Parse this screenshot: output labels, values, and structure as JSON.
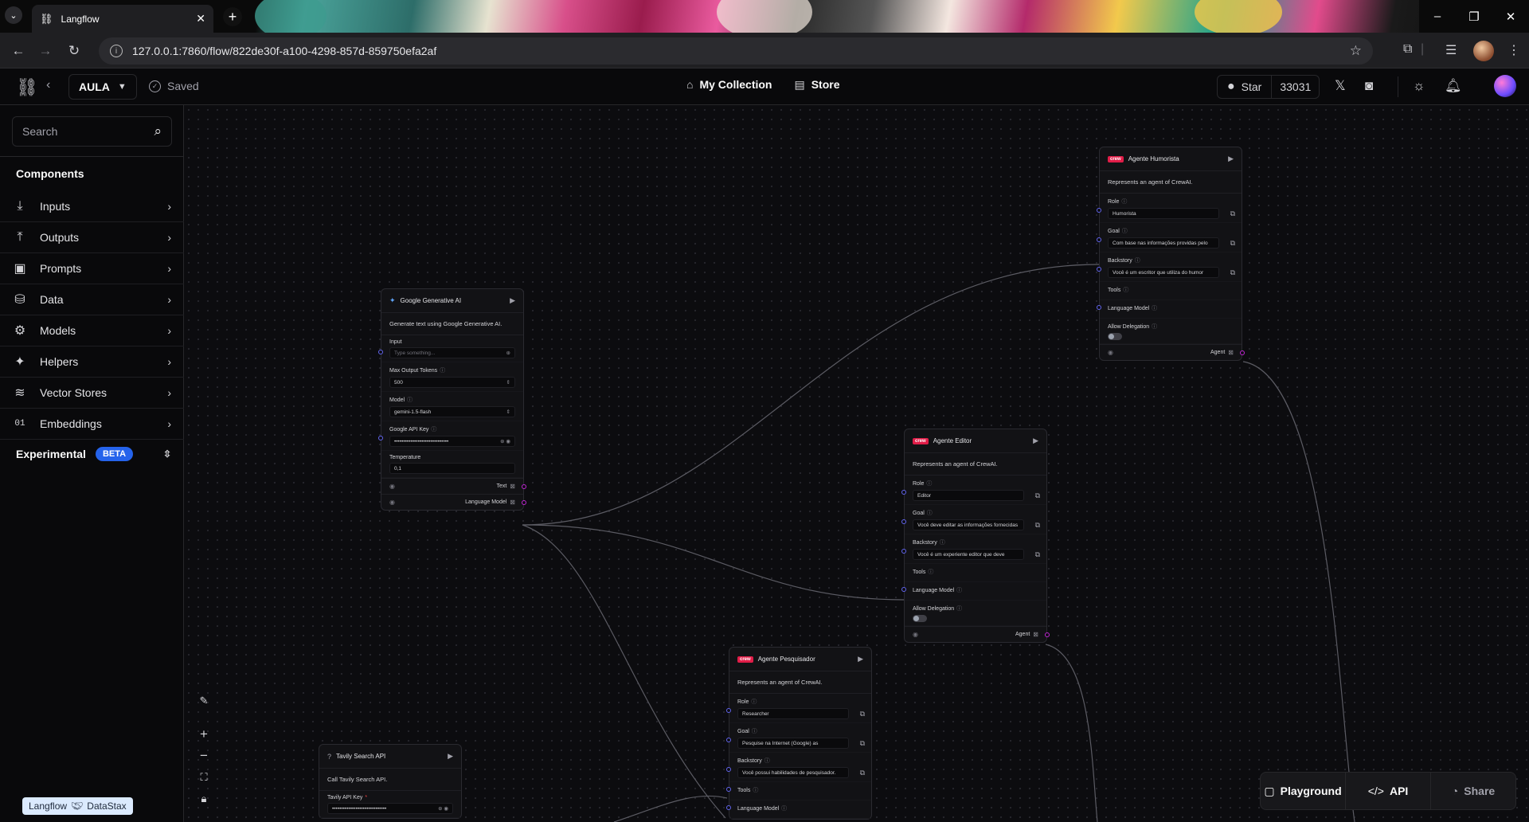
{
  "browser": {
    "tab_title": "Langflow",
    "url": "127.0.0.1:7860/flow/822de30f-a100-4298-857d-859750efa2af"
  },
  "header": {
    "flow_name": "AULA",
    "saved_label": "Saved",
    "nav": {
      "collection": "My Collection",
      "store": "Store"
    },
    "github": {
      "star_label": "Star",
      "star_count": "33031"
    }
  },
  "sidebar": {
    "search_placeholder": "Search",
    "components_title": "Components",
    "categories": [
      {
        "label": "Inputs",
        "icon": "download-icon"
      },
      {
        "label": "Outputs",
        "icon": "upload-icon"
      },
      {
        "label": "Prompts",
        "icon": "terminal-icon"
      },
      {
        "label": "Data",
        "icon": "database-icon"
      },
      {
        "label": "Models",
        "icon": "brain-icon"
      },
      {
        "label": "Helpers",
        "icon": "wand-icon"
      },
      {
        "label": "Vector Stores",
        "icon": "layers-icon"
      },
      {
        "label": "Embeddings",
        "icon": "binary-icon"
      }
    ],
    "experimental_label": "Experimental",
    "beta_badge": "BETA"
  },
  "nodes": {
    "google": {
      "title": "Google Generative AI",
      "description": "Generate text using Google Generative AI.",
      "input_label": "Input",
      "input_placeholder": "Type something...",
      "max_tokens_label": "Max Output Tokens",
      "max_tokens_value": "500",
      "model_label": "Model",
      "model_value": "gemini-1.5-flash",
      "api_key_label": "Google API Key",
      "api_key_value": "••••••••••••••••••••••••••••••",
      "temperature_label": "Temperature",
      "temperature_value": "0,1",
      "out_text": "Text",
      "out_lm": "Language Model"
    },
    "humorista": {
      "title": "Agente Humorista",
      "description": "Represents an agent of CrewAI.",
      "role_label": "Role",
      "role_value": "Humorista",
      "goal_label": "Goal",
      "goal_value": "Com base nas informações providas pelo",
      "backstory_label": "Backstory",
      "backstory_value": "Você é um escritor que utiliza do humor",
      "tools_label": "Tools",
      "lm_label": "Language Model",
      "delegation_label": "Allow Delegation",
      "out_agent": "Agent"
    },
    "editor": {
      "title": "Agente Editor",
      "description": "Represents an agent of CrewAI.",
      "role_label": "Role",
      "role_value": "Editor",
      "goal_label": "Goal",
      "goal_value": "Você deve editar as informações fornecidas",
      "backstory_label": "Backstory",
      "backstory_value": "Você é um experiente editor que deve",
      "tools_label": "Tools",
      "lm_label": "Language Model",
      "delegation_label": "Allow Delegation",
      "out_agent": "Agent"
    },
    "pesquisador": {
      "title": "Agente Pesquisador",
      "description": "Represents an agent of CrewAI.",
      "role_label": "Role",
      "role_value": "Researcher",
      "goal_label": "Goal",
      "goal_value": "Pesquise na Internet (Google) as",
      "backstory_label": "Backstory",
      "backstory_value": "Você possui habilidades de pesquisador.",
      "tools_label": "Tools",
      "lm_label": "Language Model"
    },
    "tavily": {
      "title": "Tavily Search API",
      "description": "Call Tavily Search API.",
      "api_key_label": "Tavily API Key",
      "api_key_value": "••••••••••••••••••••••••••••••"
    }
  },
  "badge": {
    "langflow": "Langflow",
    "datastax": "DataStax"
  },
  "actions": {
    "playground": "Playground",
    "api": "API",
    "share": "Share"
  },
  "colors": {
    "beta": "#2563eb",
    "handle_in": "#6366f1",
    "handle_out": "#c026d3"
  }
}
